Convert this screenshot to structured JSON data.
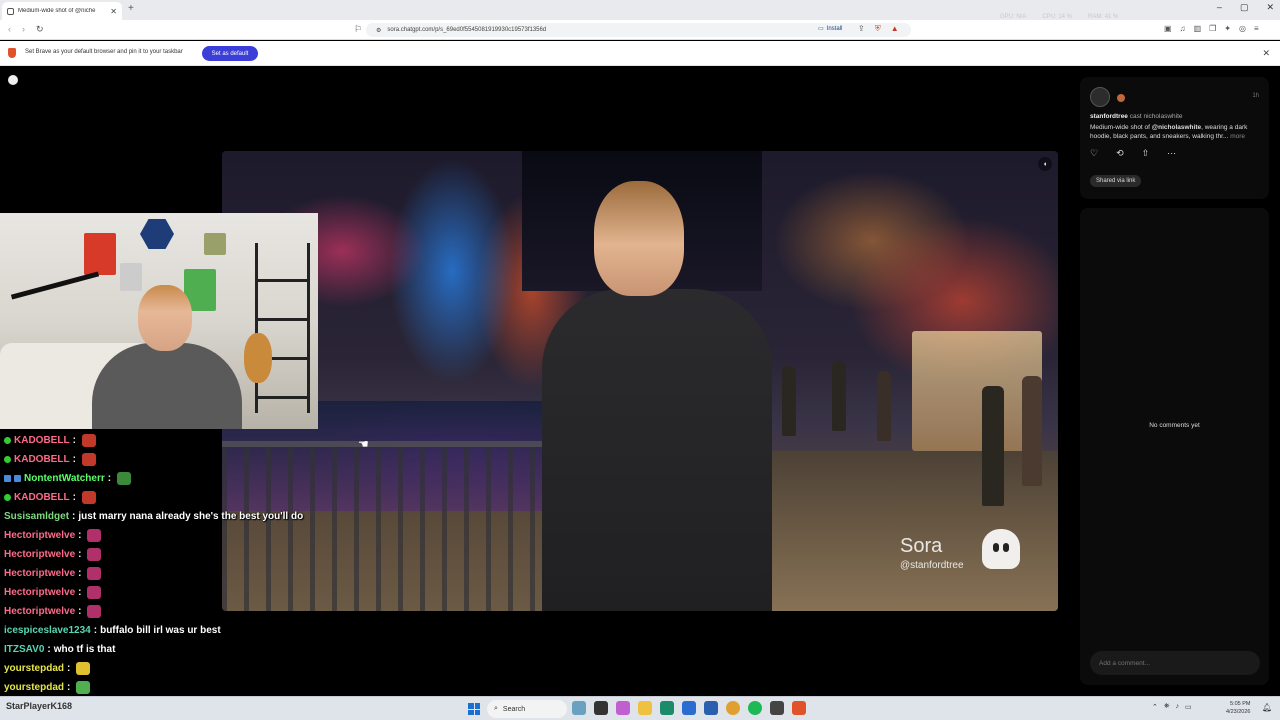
{
  "browser": {
    "tab_title": "Medium-wide shot of @niche",
    "url": "sora.chatgpt.com/p/s_69ed0f5545081919930c19573f1356d",
    "install_label": "Install",
    "sys_readouts": [
      "GPU: N/A",
      "CPU: 14 %",
      "RAM: 41 %"
    ]
  },
  "infobar": {
    "message": "Set Brave as your default browser and pin it to your taskbar",
    "button_label": "Set as default"
  },
  "video": {
    "watermark_name": "Sora",
    "watermark_handle": "@stanfordtree"
  },
  "post": {
    "author": "stanfordtree",
    "cast_label": "cast nicholaswhite",
    "time": "1h",
    "desc_prefix": "Medium-wide shot of ",
    "desc_mention": "@nicholaswhite",
    "desc_rest": ", wearing a dark hoodie, black pants, and sneakers, walking thr...",
    "more": "more",
    "shared_label": "Shared via link"
  },
  "comments": {
    "empty_label": "No comments yet",
    "placeholder": "Add a comment..."
  },
  "chat": [
    {
      "user": "KADOBELL",
      "color": "#ff6a8a",
      "text": "",
      "badge": "green",
      "emote": "#c0392b"
    },
    {
      "user": "KADOBELL",
      "color": "#ff6a8a",
      "text": "",
      "badge": "green",
      "emote": "#c0392b"
    },
    {
      "user": "NontentWatcherr",
      "color": "#5cff6a",
      "text": "",
      "badge": "blue",
      "emote": "#3b8a3b"
    },
    {
      "user": "KADOBELL",
      "color": "#ff6a8a",
      "text": "",
      "badge": "green",
      "emote": "#c0392b"
    },
    {
      "user": "Susisamldget",
      "color": "#7fd97f",
      "text": "just marry nana already she's the best you'll do",
      "badge": "",
      "emote": ""
    },
    {
      "user": "Hectoriptwelve",
      "color": "#ff6a8a",
      "text": "",
      "badge": "",
      "emote": "#b0306a"
    },
    {
      "user": "Hectoriptwelve",
      "color": "#ff6a8a",
      "text": "",
      "badge": "",
      "emote": "#b0306a"
    },
    {
      "user": "Hectoriptwelve",
      "color": "#ff6a8a",
      "text": "",
      "badge": "",
      "emote": "#b0306a"
    },
    {
      "user": "Hectoriptwelve",
      "color": "#ff6a8a",
      "text": "",
      "badge": "",
      "emote": "#b0306a"
    },
    {
      "user": "Hectoriptwelve",
      "color": "#ff6a8a",
      "text": "",
      "badge": "",
      "emote": "#b0306a"
    },
    {
      "user": "icespiceslave1234",
      "color": "#59d6b4",
      "text": "buffalo bill irl was ur best",
      "badge": "",
      "emote": ""
    },
    {
      "user": "ITZSAV0",
      "color": "#59d6b4",
      "text": "who tf is that",
      "badge": "",
      "emote": ""
    },
    {
      "user": "yourstepdad",
      "color": "#e6e64a",
      "text": "",
      "badge": "",
      "emote": "#e0c030"
    },
    {
      "user": "yourstepdad",
      "color": "#e6e64a",
      "text": "",
      "badge": "",
      "emote": "#50b050"
    }
  ],
  "taskbar": {
    "left_label": "StarPlayerK168",
    "search_label": "Search",
    "time": "5:05 PM",
    "date": "4/23/2026"
  }
}
